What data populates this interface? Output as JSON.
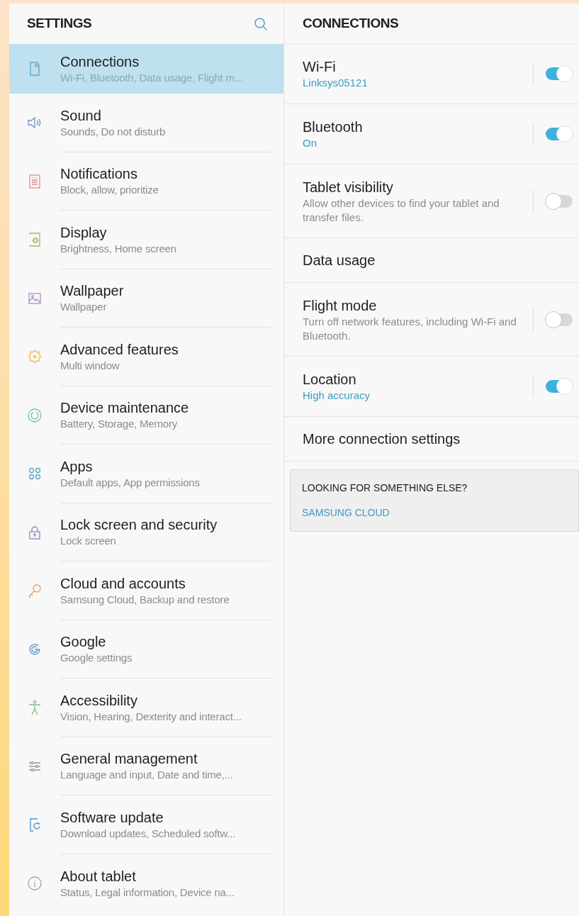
{
  "sidebar": {
    "title": "SETTINGS",
    "items": [
      {
        "label": "Connections",
        "summary": "Wi-Fi, Bluetooth, Data usage, Flight m...",
        "selected": true
      },
      {
        "label": "Sound",
        "summary": "Sounds, Do not disturb",
        "selected": false
      },
      {
        "label": "Notifications",
        "summary": "Block, allow, prioritize",
        "selected": false
      },
      {
        "label": "Display",
        "summary": "Brightness, Home screen",
        "selected": false
      },
      {
        "label": "Wallpaper",
        "summary": "Wallpaper",
        "selected": false
      },
      {
        "label": "Advanced features",
        "summary": "Multi window",
        "selected": false
      },
      {
        "label": "Device maintenance",
        "summary": "Battery, Storage, Memory",
        "selected": false
      },
      {
        "label": "Apps",
        "summary": "Default apps, App permissions",
        "selected": false
      },
      {
        "label": "Lock screen and security",
        "summary": "Lock screen",
        "selected": false
      },
      {
        "label": "Cloud and accounts",
        "summary": "Samsung Cloud, Backup and restore",
        "selected": false
      },
      {
        "label": "Google",
        "summary": "Google settings",
        "selected": false
      },
      {
        "label": "Accessibility",
        "summary": "Vision, Hearing, Dexterity and interact...",
        "selected": false
      },
      {
        "label": "General management",
        "summary": "Language and input, Date and time,...",
        "selected": false
      },
      {
        "label": "Software update",
        "summary": "Download updates, Scheduled softw...",
        "selected": false
      },
      {
        "label": "About tablet",
        "summary": "Status, Legal information, Device na...",
        "selected": false
      }
    ]
  },
  "detail": {
    "title": "CONNECTIONS",
    "rows": [
      {
        "kind": "toggle",
        "label": "Wi-Fi",
        "status": "Linksys05121",
        "on": true
      },
      {
        "kind": "toggle",
        "label": "Bluetooth",
        "status": "On",
        "on": true
      },
      {
        "kind": "toggle",
        "label": "Tablet visibility",
        "description": "Allow other devices to find your tablet and transfer files.",
        "on": false
      },
      {
        "kind": "link",
        "label": "Data usage"
      },
      {
        "kind": "toggle",
        "label": "Flight mode",
        "description": "Turn off network features, including Wi-Fi and Bluetooth.",
        "on": false
      },
      {
        "kind": "toggle",
        "label": "Location",
        "status": "High accuracy",
        "on": true
      },
      {
        "kind": "link",
        "label": "More connection settings"
      }
    ],
    "suggestion": {
      "heading": "LOOKING FOR SOMETHING ELSE?",
      "link": "SAMSUNG CLOUD"
    }
  }
}
